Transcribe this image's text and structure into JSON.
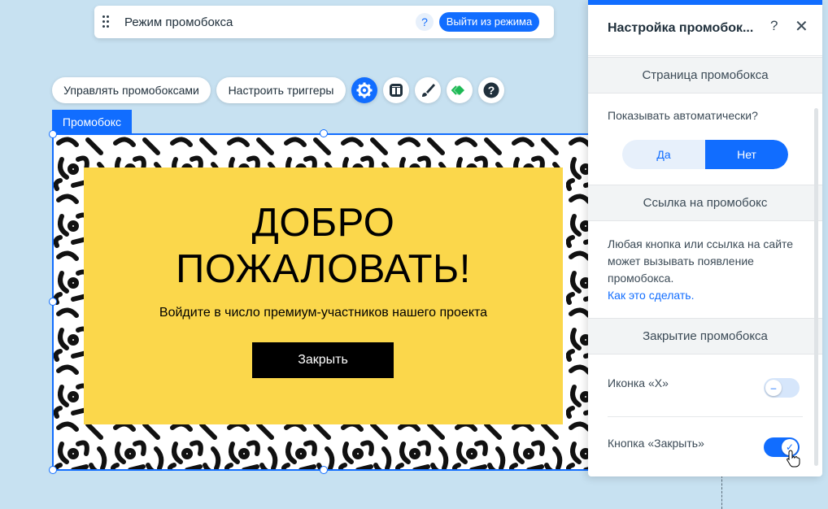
{
  "colors": {
    "accent": "#116dff",
    "canvas_bg": "#c7e1f1",
    "card_bg": "#fbd74b"
  },
  "modebar": {
    "title": "Режим промобокса",
    "help_glyph": "?",
    "exit_label": "Выйти из режима"
  },
  "toolbar": {
    "manage_label": "Управлять промобоксами",
    "triggers_label": "Настроить триггеры",
    "icons": [
      "gear-icon",
      "layout-icon",
      "brush-icon",
      "animation-icon",
      "help-icon"
    ]
  },
  "selection": {
    "label": "Промобокс"
  },
  "lightbox": {
    "heading_line1": "ДОБРО",
    "heading_line2": "ПОЖАЛОВАТЬ!",
    "subtitle": "Войдите в число премиум-участников нашего проекта",
    "close_button": "Закрыть"
  },
  "panel": {
    "title": "Настройка промобок...",
    "help_glyph": "?",
    "close_glyph": "✕",
    "sections": {
      "page": {
        "header": "Страница промобокса",
        "auto_show_label": "Показывать автоматически?",
        "options": [
          "Да",
          "Нет"
        ],
        "selected": "Нет"
      },
      "link": {
        "header": "Ссылка на промобокс",
        "text_line1": "Любая кнопка или ссылка на сайте",
        "text_line2": "может вызывать появление",
        "text_line3": "промобокса.",
        "link_text": "Как это сделать."
      },
      "close": {
        "header": "Закрытие промобокса",
        "x_icon_label": "Иконка «X»",
        "x_icon_enabled": false,
        "x_knob_glyph": "–",
        "close_button_label": "Кнопка «Закрыть»",
        "close_button_enabled": true,
        "close_knob_glyph": "✓"
      }
    }
  }
}
